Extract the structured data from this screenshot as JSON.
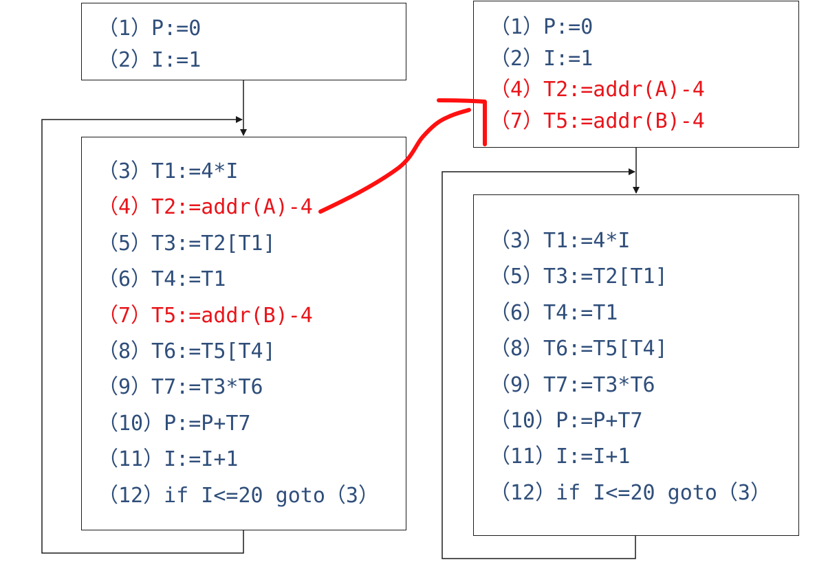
{
  "left": {
    "init_block": [
      {
        "text": "（1）P:=0",
        "hl": false
      },
      {
        "text": "（2）I:=1",
        "hl": false
      }
    ],
    "loop_block": [
      {
        "text": "（3）T1:=4*I",
        "hl": false
      },
      {
        "text": "（4）T2:=addr(A)-4",
        "hl": true
      },
      {
        "text": "（5）T3:=T2[T1]",
        "hl": false
      },
      {
        "text": "（6）T4:=T1",
        "hl": false
      },
      {
        "text": "（7）T5:=addr(B)-4",
        "hl": true
      },
      {
        "text": "（8）T6:=T5[T4]",
        "hl": false
      },
      {
        "text": "（9）T7:=T3*T6",
        "hl": false
      },
      {
        "text": "（10）P:=P+T7",
        "hl": false
      },
      {
        "text": "（11）I:=I+1",
        "hl": false
      },
      {
        "text": "（12）if I<=20 goto（3）",
        "hl": false
      }
    ]
  },
  "right": {
    "init_block": [
      {
        "text": "（1）P:=0",
        "hl": false
      },
      {
        "text": "（2）I:=1",
        "hl": false
      },
      {
        "text": "（4）T2:=addr(A)-4",
        "hl": true
      },
      {
        "text": "（7）T5:=addr(B)-4",
        "hl": true
      }
    ],
    "loop_block": [
      {
        "text": "（3）T1:=4*I",
        "hl": false
      },
      {
        "text": "（5）T3:=T2[T1]",
        "hl": false
      },
      {
        "text": "（6）T4:=T1",
        "hl": false
      },
      {
        "text": "（8）T6:=T5[T4]",
        "hl": false
      },
      {
        "text": "（9）T7:=T3*T6",
        "hl": false
      },
      {
        "text": "（10）P:=P+T7",
        "hl": false
      },
      {
        "text": "（11）I:=I+1",
        "hl": false
      },
      {
        "text": "（12）if I<=20 goto（3）",
        "hl": false
      }
    ]
  },
  "colors": {
    "code_text": "#2f4e7a",
    "highlight_text": "#e8141a",
    "annotation_stroke": "#ff1010",
    "edge_stroke": "#1a1a1a"
  }
}
